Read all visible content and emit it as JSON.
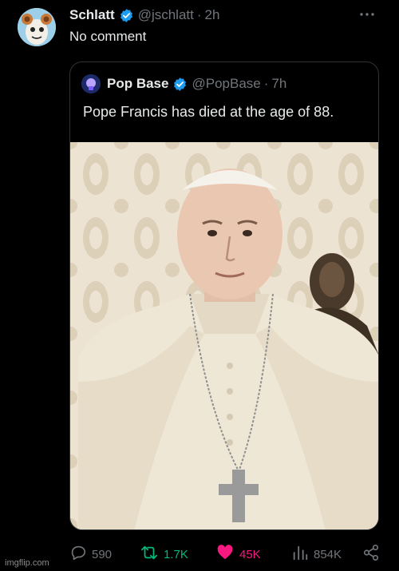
{
  "post": {
    "author_name": "Schlatt",
    "author_handle": "@jschlatt",
    "separator": "·",
    "time": "2h",
    "text": "No comment"
  },
  "quoted_post": {
    "author_name": "Pop Base",
    "author_handle": "@PopBase",
    "separator": "·",
    "time": "7h",
    "text": "Pope Francis has died at the age of 88."
  },
  "actions": {
    "replies": "590",
    "reposts": "1.7K",
    "likes": "45K",
    "views": "854K"
  },
  "watermark": "imgflip.com",
  "colors": {
    "background": "#000000",
    "text": "#e7e9ea",
    "muted": "#71767b",
    "verified": "#1d9bf0",
    "repost_green": "#00ba7c",
    "like_pink": "#f91880"
  },
  "icons": {
    "verified": "verified-badge-icon",
    "more": "more-options-icon",
    "reply": "reply-icon",
    "repost": "repost-icon",
    "like": "like-heart-icon",
    "views": "views-icon",
    "share": "share-icon"
  }
}
